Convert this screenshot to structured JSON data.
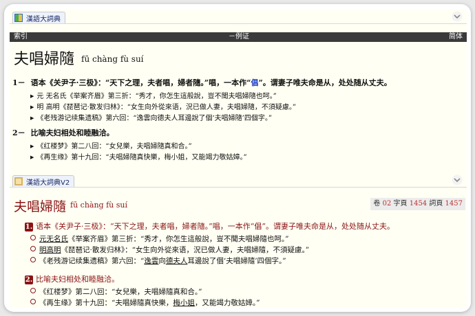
{
  "dict1": {
    "tab_label": "漢語大詞典",
    "bar": {
      "left": "索引",
      "center": "－例证",
      "right": "简体"
    },
    "headword": "夫唱婦隨",
    "pinyin": "fū chàng fù suí",
    "senses": [
      {
        "num": "1－",
        "pre": "语本《关尹子·三极》：“天下之理，夫者唱，婦者隨。”唱，一本作“",
        "hl": "倡",
        "post": "”。谓妻子唯夫命是从，处处随从丈夫。",
        "examples": [
          "元 无名氏《举案齐眉》第三折：“秀才，你怎生這般說，豈不聞夫唱婦隨也呵。”",
          "明 高明《琵琶记·散发归林》：“女生向外從來语，況已做人妻，夫唱婦隨，不須疑慮。”",
          "《老残游记续集遗稿》第六回：“逸雲向德夫人耳邊說了個‘夫唱婦隨’四個字。”"
        ]
      },
      {
        "num": "2－",
        "pre": "比喻夫妇相处和睦融洽。",
        "hl": "",
        "post": "",
        "examples": [
          "《红楼梦》第二八回：“女兒樂，夫唱婦隨真和合。”",
          "《再生缘》第十九回：“夫唱婦隨真快樂，梅小姐，又能竭力敬姑嫜。”"
        ]
      }
    ]
  },
  "dict2": {
    "tab_label": "漢語大詞典V2",
    "headword": "夫唱婦隨",
    "pinyin": "fū chàng fù suí",
    "vol_label": "卷",
    "vol_num": "02",
    "zi_label": "字頁",
    "zi_num": "1454",
    "ci_label": "詞頁",
    "ci_num": "1457",
    "senses": [
      {
        "badge": "1.",
        "text": "语本《关尹子·三极》：“天下之理，夫者唱，婦者隨。”唱，一本作“倡”。谓妻子唯夫命是从，处处随从丈夫。",
        "examples": [
          {
            "u": "元无名氏",
            "mid": "《举案齐眉》第三折：“秀才，你怎生這般說，豈不聞夫唱婦隨也呵。”",
            "u2": "",
            "tail": ""
          },
          {
            "u": "明高明",
            "mid": "《琵琶记·散发归林》：“女生向外從來语，況已做人妻，夫唱婦隨，不須疑慮。”",
            "u2": "",
            "tail": ""
          },
          {
            "u": "",
            "mid": "《老残游记续集遗稿》第六回：“",
            "u2": "逸雲",
            "tail": "向"
          },
          {}
        ]
      },
      {
        "badge": "2.",
        "text": "比喻夫妇相处和睦融洽。",
        "examples": [
          {
            "u": "",
            "mid": "《红楼梦》第二八回：“女兒樂，夫唱婦隨真和合。”"
          },
          {
            "u": "",
            "mid": "《再生缘》第十九回：“夫唱婦隨真快樂，",
            "u2": "梅小姐",
            "tail": "，又能竭力敬姑嫜。”"
          }
        ]
      }
    ],
    "ex3_u3": "德夫人",
    "ex3_tail": "耳邊說了個‘夫唱婦隨’四個字。”"
  }
}
